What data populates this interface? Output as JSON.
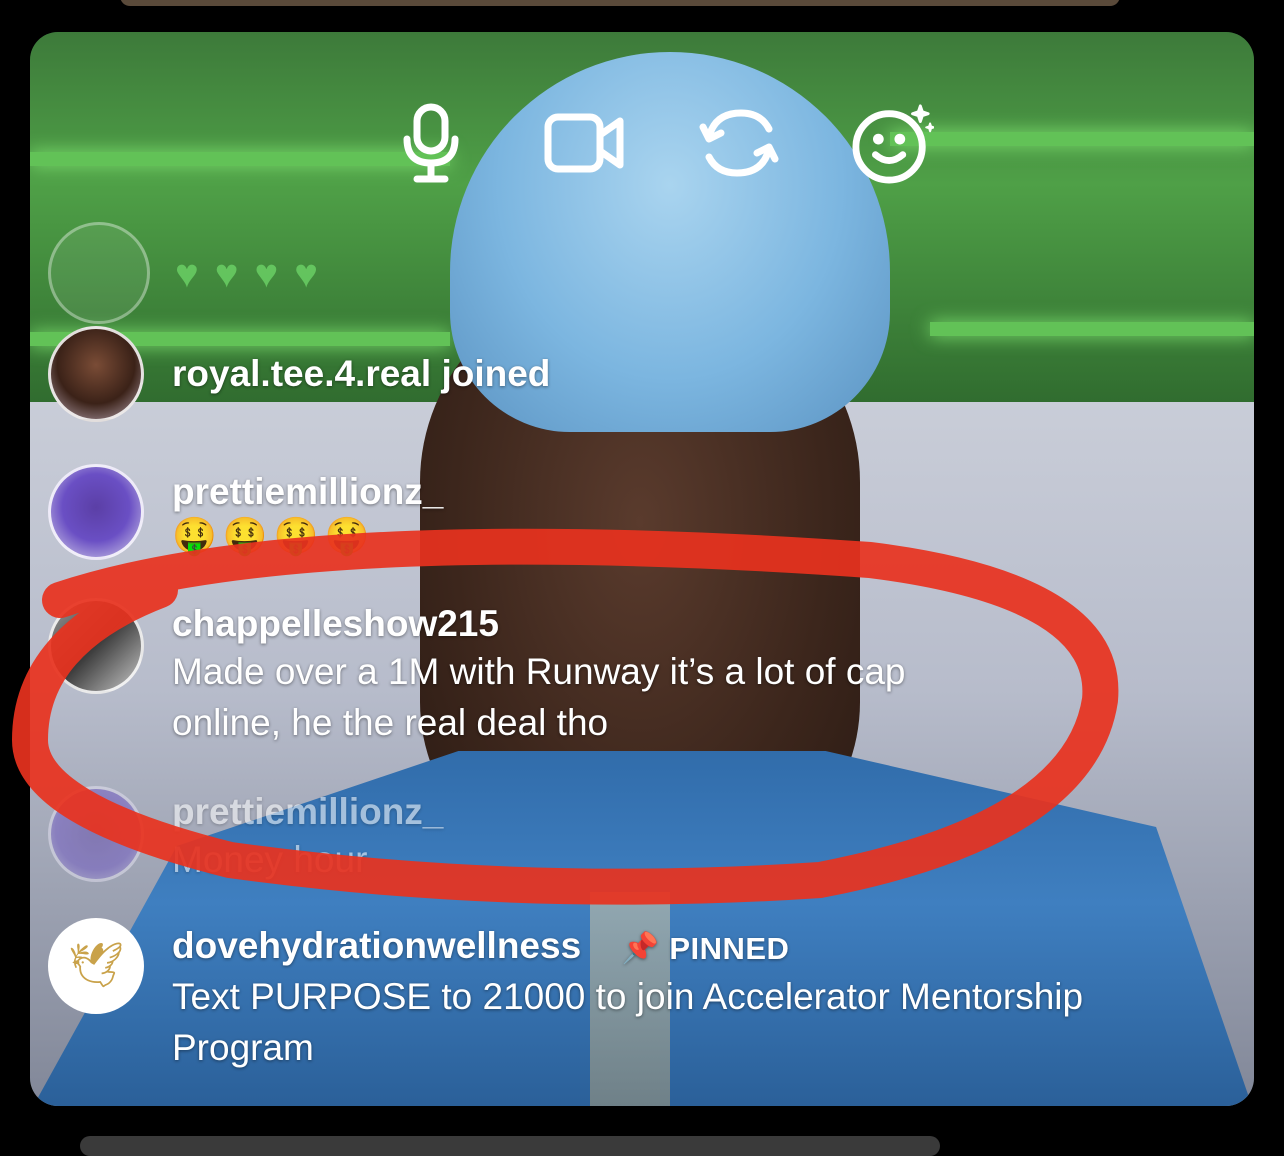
{
  "controls": [
    {
      "name": "microphone-icon"
    },
    {
      "name": "video-camera-icon"
    },
    {
      "name": "flip-camera-icon"
    },
    {
      "name": "effects-icon"
    }
  ],
  "comments": [
    {
      "username": "royal.tee.4.real joined",
      "text": ""
    },
    {
      "username": "prettiemillionz_",
      "text": "🤑🤑🤑🤑"
    },
    {
      "username": "chappelleshow215",
      "text_line1": "Made over a 1M with Runway it’s a lot of cap",
      "text_line2": "online, he the real deal tho"
    },
    {
      "username": "prettiemillionz_",
      "text": "Money hour"
    },
    {
      "username": "dovehydrationwellness",
      "pinned_label": "PINNED",
      "text_line1": "Text PURPOSE to 21000 to join Accelerator Mentorship",
      "text_line2": "Program"
    }
  ],
  "colors": {
    "annotation": "#e8321e",
    "heart": "#6fd86a"
  }
}
